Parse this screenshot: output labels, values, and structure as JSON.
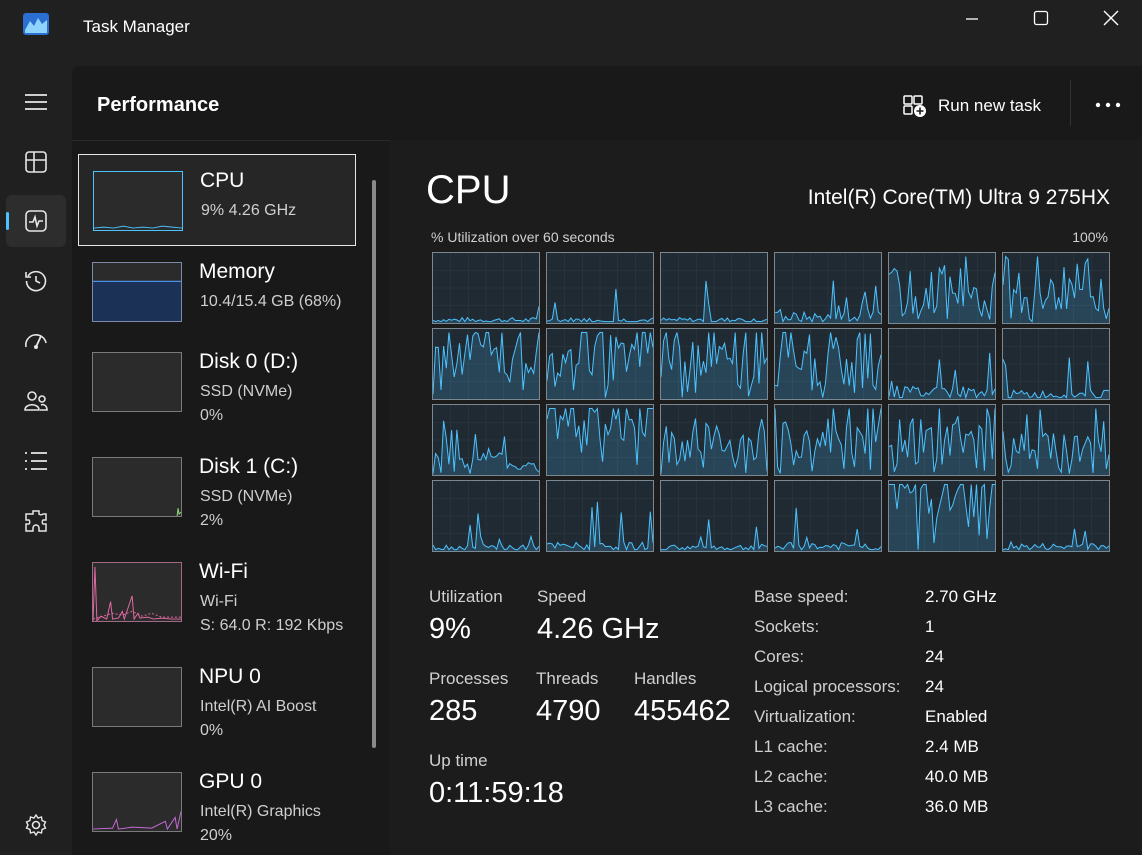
{
  "app": {
    "title": "Task Manager"
  },
  "nav": {
    "items": [
      {
        "icon": "hamburger-menu-icon"
      },
      {
        "icon": "processes-icon"
      },
      {
        "icon": "performance-icon",
        "active": true
      },
      {
        "icon": "app-history-icon"
      },
      {
        "icon": "startup-apps-icon"
      },
      {
        "icon": "users-icon"
      },
      {
        "icon": "details-icon"
      },
      {
        "icon": "services-icon"
      },
      {
        "icon": "settings-icon"
      }
    ]
  },
  "header": {
    "title": "Performance",
    "run_new_task": "Run new task"
  },
  "resources": [
    {
      "name": "CPU",
      "line1": "9%  4.26 GHz",
      "line2": "",
      "selected": true,
      "color": "#4cc2ff"
    },
    {
      "name": "Memory",
      "line1": "10.4/15.4 GB (68%)",
      "line2": "",
      "color": "#4c8fe0"
    },
    {
      "name": "Disk 0 (D:)",
      "line1": "SSD (NVMe)",
      "line2": "0%",
      "color": "#8cd97a"
    },
    {
      "name": "Disk 1 (C:)",
      "line1": "SSD (NVMe)",
      "line2": "2%",
      "color": "#8cd97a"
    },
    {
      "name": "Wi-Fi",
      "line1": "Wi-Fi",
      "line2": "S: 64.0  R: 192 Kbps",
      "color": "#e36aa4"
    },
    {
      "name": "NPU 0",
      "line1": "Intel(R) AI Boost",
      "line2": "0%",
      "color": "#4cc2ff"
    },
    {
      "name": "GPU 0",
      "line1": "Intel(R) Graphics",
      "line2": "20%",
      "color": "#c66ad8"
    }
  ],
  "detail": {
    "title": "CPU",
    "model": "Intel(R) Core(TM) Ultra 9 275HX",
    "graph_label": "% Utilization over 60 seconds",
    "graph_max": "100%",
    "graph_color": "#4cc2ff",
    "logical_processor_graphs": 24,
    "stats": {
      "utilization_label": "Utilization",
      "utilization": "9%",
      "speed_label": "Speed",
      "speed": "4.26 GHz",
      "processes_label": "Processes",
      "processes": "285",
      "threads_label": "Threads",
      "threads": "4790",
      "handles_label": "Handles",
      "handles": "455462",
      "uptime_label": "Up time",
      "uptime": "0:11:59:18"
    },
    "specs": [
      {
        "label": "Base speed:",
        "value": "2.70 GHz"
      },
      {
        "label": "Sockets:",
        "value": "1"
      },
      {
        "label": "Cores:",
        "value": "24"
      },
      {
        "label": "Logical processors:",
        "value": "24"
      },
      {
        "label": "Virtualization:",
        "value": "Enabled"
      },
      {
        "label": "L1 cache:",
        "value": "2.4 MB"
      },
      {
        "label": "L2 cache:",
        "value": "40.0 MB"
      },
      {
        "label": "L3 cache:",
        "value": "36.0 MB"
      }
    ]
  }
}
